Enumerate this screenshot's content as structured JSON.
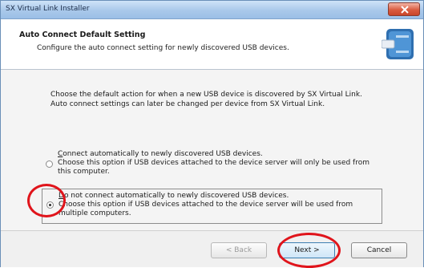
{
  "window": {
    "title": "SX Virtual Link Installer"
  },
  "header": {
    "title": "Auto Connect Default Setting",
    "subtitle": "Configure the auto connect setting for newly discovered USB devices."
  },
  "intro": {
    "line1": "Choose the default action for when a new USB device is discovered by SX Virtual Link.",
    "line2": "Auto connect settings can later be changed per device from SX Virtual Link."
  },
  "options": [
    {
      "label_accel": "C",
      "label_rest": "onnect automatically to newly discovered USB devices.",
      "desc": "Choose this option if USB devices attached to the device server will only be used from this computer.",
      "selected": false
    },
    {
      "label_accel": "D",
      "label_rest": "o not connect automatically to newly discovered USB devices.",
      "desc": "Choose this option if USB devices attached to the device server will be used from multiple computers.",
      "selected": true
    }
  ],
  "buttons": {
    "back": "< Back",
    "next": "Next >",
    "cancel": "Cancel"
  },
  "colors": {
    "annotation": "#e0141b",
    "titlebar": "#a9c8ea"
  }
}
